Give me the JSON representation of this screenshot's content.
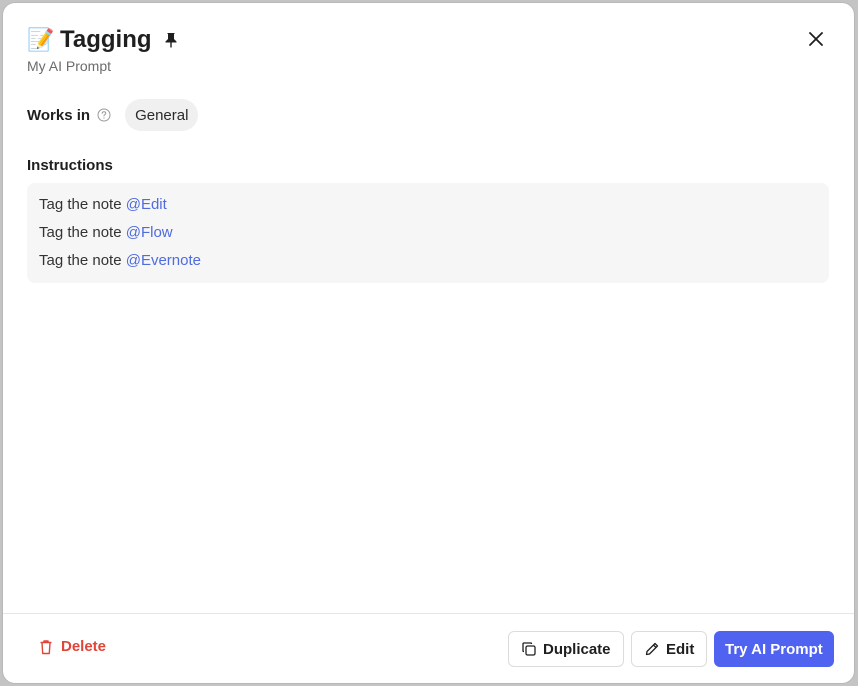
{
  "prompt": {
    "emoji": "📝",
    "title": "Tagging",
    "subtitle": "My AI Prompt"
  },
  "works_in": {
    "label": "Works in",
    "chip": "General"
  },
  "instructions": {
    "label": "Instructions",
    "lines": [
      {
        "text": "Tag the note ",
        "mention": "@Edit"
      },
      {
        "text": "Tag the note ",
        "mention": "@Flow"
      },
      {
        "text": "Tag the note ",
        "mention": "@Evernote"
      }
    ]
  },
  "footer": {
    "delete_label": "Delete",
    "duplicate_label": "Duplicate",
    "edit_label": "Edit",
    "try_label": "Try AI Prompt"
  },
  "colors": {
    "accent": "#5063f0",
    "mention": "#4f6bdc",
    "danger": "#e0453a"
  },
  "icons": {
    "pin": "pin-icon",
    "close": "close-icon",
    "help": "help-circle-icon",
    "delete": "trash-icon",
    "duplicate": "copy-icon",
    "edit": "pencil-icon"
  }
}
